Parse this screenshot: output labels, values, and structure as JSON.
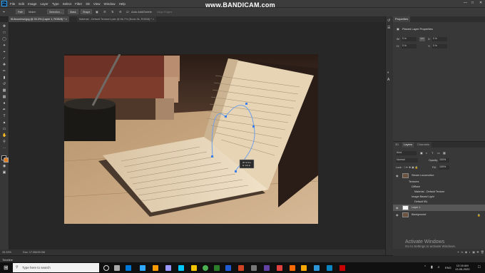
{
  "watermark": "www.BANDICAM.com",
  "menu": [
    "File",
    "Edit",
    "Image",
    "Layer",
    "Type",
    "Select",
    "Filter",
    "3D",
    "View",
    "Window",
    "Help"
  ],
  "options_bar": {
    "mode": "Path",
    "make": "Make:",
    "selection_btn": "Selection...",
    "mask_btn": "Mask",
    "shape_btn": "Shape",
    "auto_add_delete": "Auto Add/Delete",
    "align_edges": "Align Edges"
  },
  "tabs": [
    {
      "label": "5f-8cccnhvd.jpg @ 33.3% (Layer 1, RGB/8) *",
      "active": true
    },
    {
      "label": "Material - Default Texture1.psb @ 66.7% (Book-5k, RGB/8) *",
      "active": false
    }
  ],
  "status": {
    "zoom": "33.33%",
    "doc": "Doc: 17.0M/49.0M"
  },
  "timeline_label": "Timeline",
  "properties": {
    "tab": "Properties",
    "header": "Placed Layer Properties",
    "w_label": "W:",
    "w_value": "0 in",
    "x_label": "X:",
    "x_value": "0 in",
    "h_label": "H:",
    "h_value": "0 in",
    "y_label": "Y:",
    "y_value": "0 in",
    "go_value": "GO"
  },
  "layers_panel": {
    "tabs": [
      "3D",
      "Layers",
      "Channels"
    ],
    "kind_label": "Kind",
    "blend_mode": "Normal",
    "opacity_label": "Opacity:",
    "opacity_value": "100%",
    "lock_label": "Lock:",
    "fill_label": "Fill:",
    "fill_value": "100%",
    "layers": [
      {
        "name": "Steam Locomotive",
        "indent": 0,
        "thumb": true
      },
      {
        "name": "Textures",
        "indent": 1,
        "thumb": false
      },
      {
        "name": "Diffuse",
        "indent": 2,
        "thumb": false
      },
      {
        "name": "Material - Default Texture",
        "indent": 3,
        "thumb": false
      },
      {
        "name": "Image Based Light",
        "indent": 2,
        "thumb": false
      },
      {
        "name": "Default IBL",
        "indent": 3,
        "thumb": false
      },
      {
        "name": "Layer 1",
        "indent": 0,
        "thumb": true,
        "selected": true
      },
      {
        "name": "Background",
        "indent": 0,
        "thumb": true,
        "locked": true
      }
    ]
  },
  "path_tooltip": {
    "w": "W: 0.0 in",
    "h": "H: 0.0 in"
  },
  "activation": {
    "title": "Activate Windows",
    "subtitle": "Go to Settings to activate Windows."
  },
  "taskbar": {
    "search_placeholder": "Type here to search",
    "time": "12:16 AM",
    "date": "13-05-2020",
    "lang": "ENG"
  }
}
